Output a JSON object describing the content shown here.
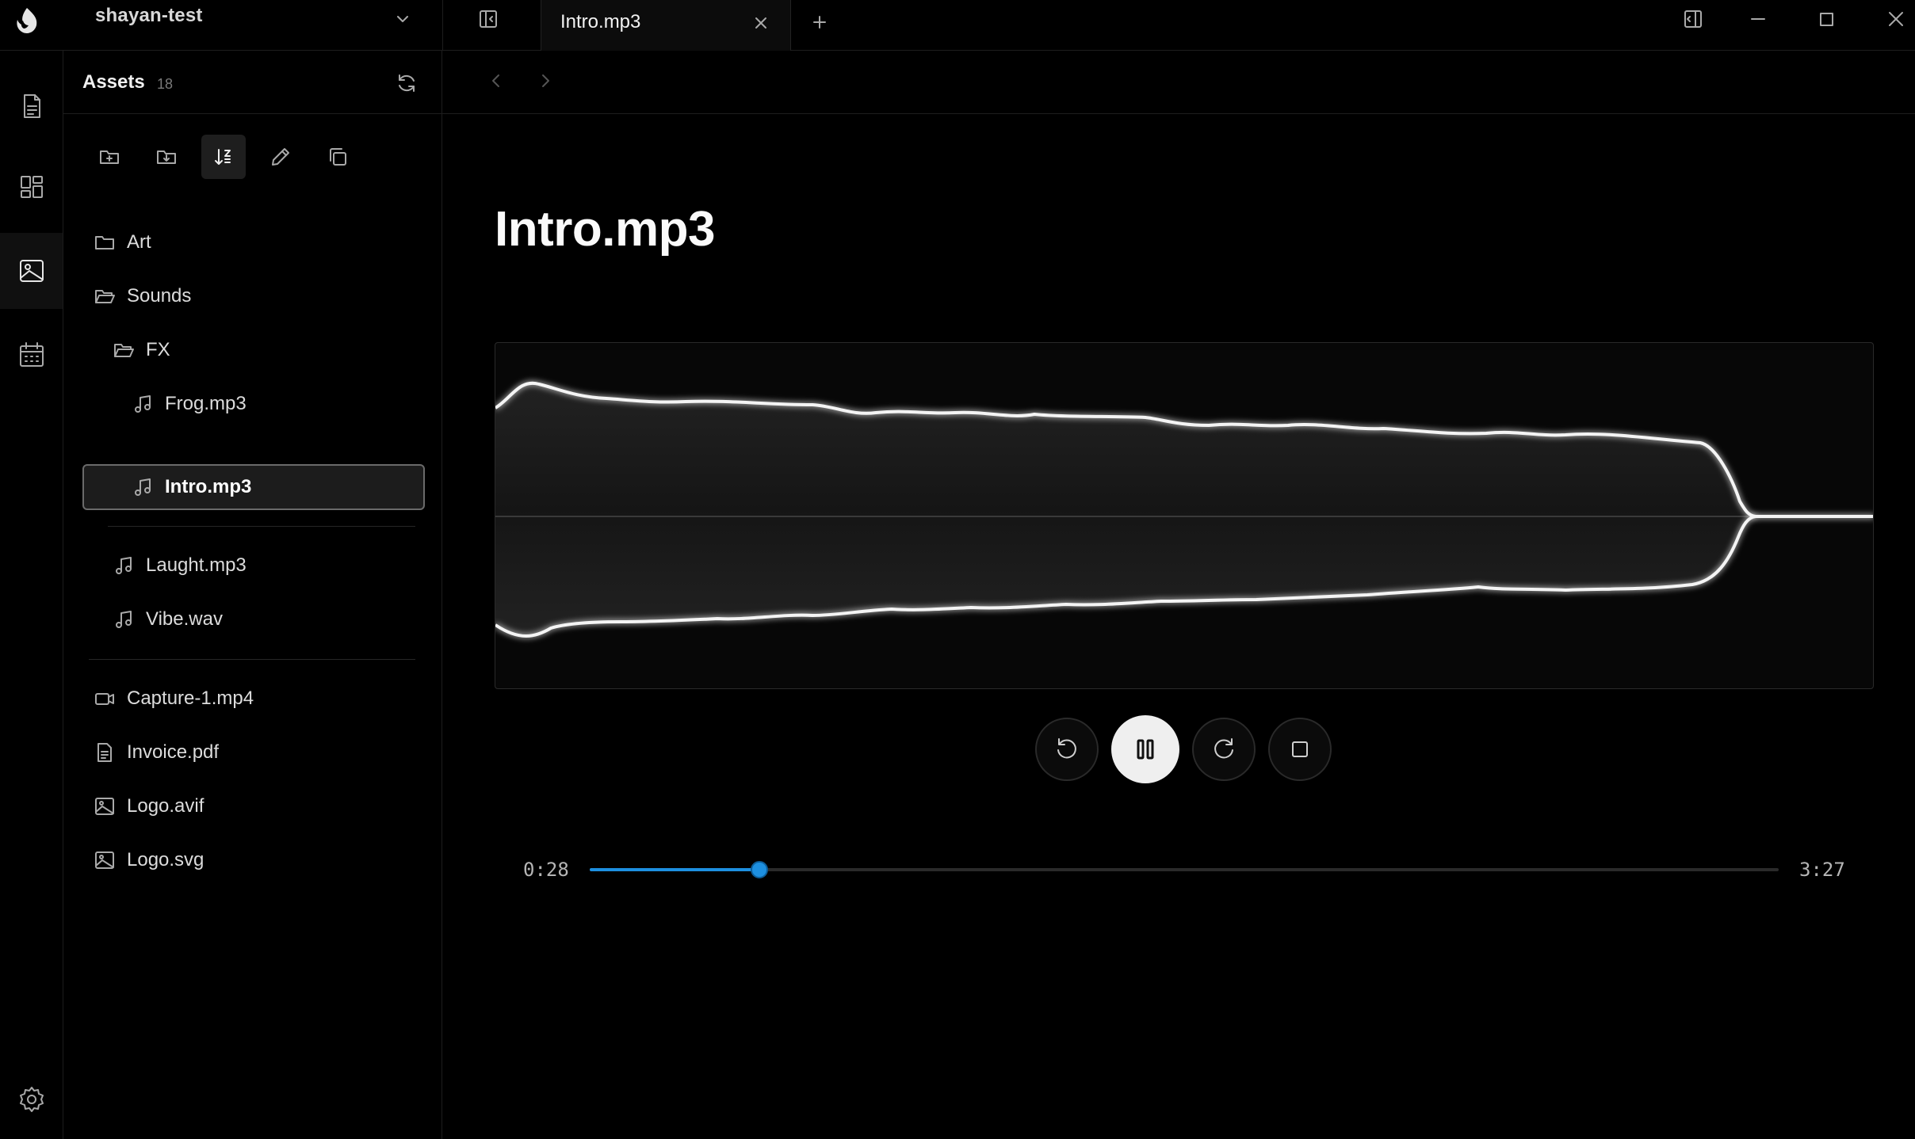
{
  "titlebar": {
    "workspace": "shayan-test",
    "tab_label": "Intro.mp3"
  },
  "sidebar": {
    "title": "Assets",
    "count": "18",
    "items": [
      {
        "label": "Art",
        "icon": "folder-icon"
      },
      {
        "label": "Sounds",
        "icon": "folder-open-icon"
      },
      {
        "label": "FX",
        "icon": "folder-open-icon"
      },
      {
        "label": "Frog.mp3",
        "icon": "music-icon"
      },
      {
        "label": "Intro.mp3",
        "icon": "music-icon",
        "selected": true
      },
      {
        "label": "Laught.mp3",
        "icon": "music-icon"
      },
      {
        "label": "Vibe.wav",
        "icon": "music-icon"
      },
      {
        "label": "Capture-1.mp4",
        "icon": "video-icon"
      },
      {
        "label": "Invoice.pdf",
        "icon": "document-icon"
      },
      {
        "label": "Logo.avif",
        "icon": "image-icon"
      },
      {
        "label": "Logo.svg",
        "icon": "image-icon"
      }
    ]
  },
  "main": {
    "title": "Intro.mp3"
  },
  "player": {
    "current_time": "0:28",
    "total_time": "3:27",
    "progress": 0.143,
    "state": "playing",
    "accent_color": "#1d8fe0"
  }
}
